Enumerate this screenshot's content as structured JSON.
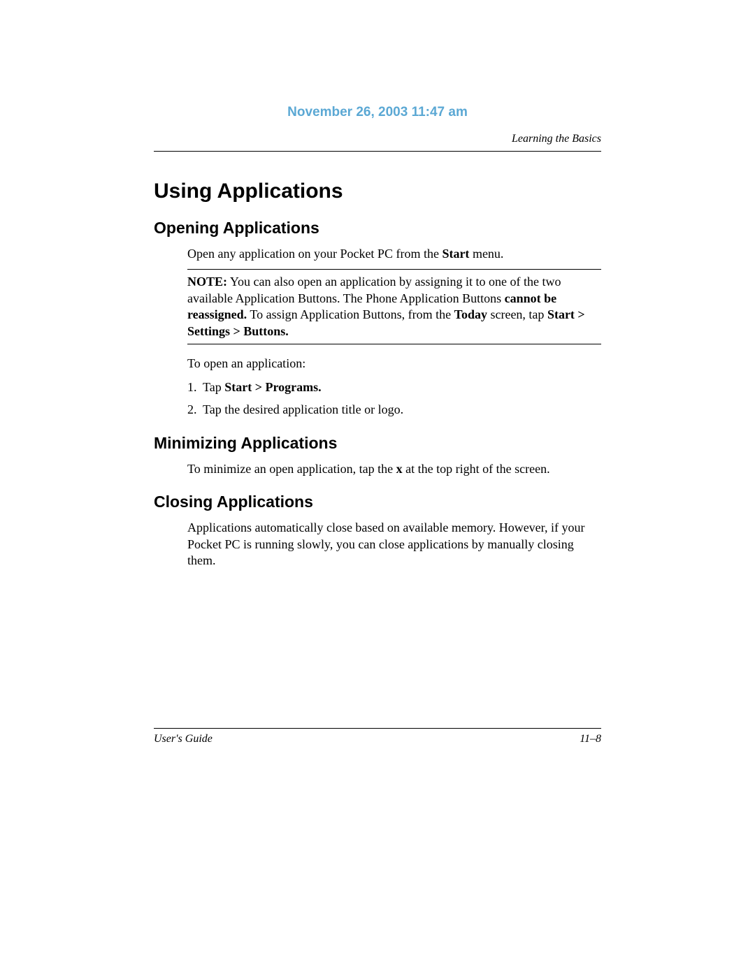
{
  "header": {
    "date": "November 26, 2003 11:47 am",
    "section_label": "Learning the Basics"
  },
  "title": "Using Applications",
  "opening": {
    "heading": "Opening Applications",
    "intro_pre": "Open any application on your Pocket PC from the ",
    "intro_bold": "Start",
    "intro_post": " menu.",
    "note_label": "NOTE:",
    "note_seg1": " You can also open an application by assigning it to one of the two available Application Buttons. The Phone Application Buttons ",
    "note_bold2": "cannot be reassigned.",
    "note_seg2": " To assign Application Buttons, from the ",
    "note_bold3": "Today",
    "note_seg3": " screen, tap ",
    "note_bold4": "Start > Settings > Buttons.",
    "lead": "To open an application:",
    "step1_num": "1.",
    "step1_pre": "Tap ",
    "step1_bold": "Start > Programs.",
    "step2_num": "2.",
    "step2": "Tap the desired application title or logo."
  },
  "minimizing": {
    "heading": "Minimizing Applications",
    "text_pre": "To minimize an open application, tap the ",
    "text_bold": "x",
    "text_post": " at the top right of the screen."
  },
  "closing": {
    "heading": "Closing Applications",
    "text": "Applications automatically close based on available memory. However, if your Pocket PC is running slowly, you can close applications by manually closing them."
  },
  "footer": {
    "left": "User's Guide",
    "right": "11–8"
  }
}
